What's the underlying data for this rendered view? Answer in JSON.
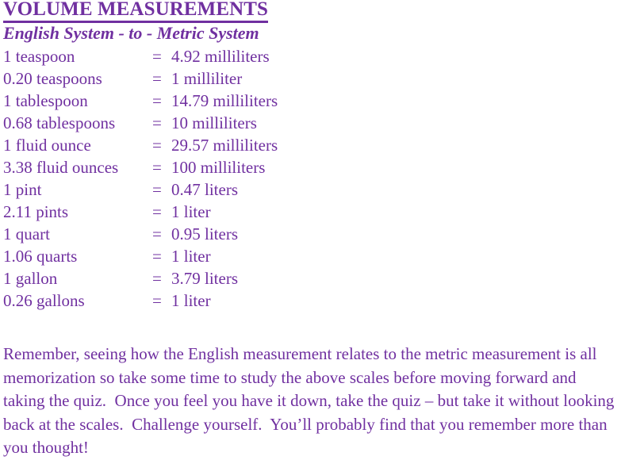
{
  "document": {
    "title": "VOLUME MEASUREMENTS",
    "subtitle": "English System - to - Metric System",
    "text_color": "#7030A0",
    "background_color": "#FFFFFF"
  },
  "conversion_table": {
    "equals_symbol": "=",
    "rows": [
      {
        "english": "1 teaspoon",
        "eq": "=",
        "metric": "4.92 milliliters"
      },
      {
        "english": "0.20 teaspoons",
        "eq": "=",
        "metric": "1 milliliter"
      },
      {
        "english": "1 tablespoon",
        "eq": "=",
        "metric": "14.79 milliliters"
      },
      {
        "english": "0.68 tablespoons",
        "eq": "=",
        "metric": "10 milliliters"
      },
      {
        "english": "1 fluid ounce",
        "eq": "=",
        "metric": "29.57 milliliters"
      },
      {
        "english": "3.38 fluid ounces",
        "eq": "=",
        "metric": "100 milliliters"
      },
      {
        "english": "1 pint",
        "eq": "=",
        "metric": "0.47 liters"
      },
      {
        "english": "2.11 pints",
        "eq": "=",
        "metric": "1 liter"
      },
      {
        "english": "1 quart",
        "eq": "=",
        "metric": "0.95 liters"
      },
      {
        "english": "1.06 quarts",
        "eq": "=",
        "metric": "1 liter"
      },
      {
        "english": "1 gallon",
        "eq": "=",
        "metric": "3.79 liters"
      },
      {
        "english": "0.26 gallons",
        "eq": "=",
        "metric": "1 liter"
      }
    ]
  },
  "closing_paragraph": {
    "text": "Remember, seeing how the English measurement relates to the metric measurement is all memorization so take some time to study the above scales before moving forward and taking the quiz.  Once you feel you have it down, take the quiz – but take it without looking back at the scales.  Challenge yourself.  You’ll probably find that you remember more than you thought!"
  }
}
